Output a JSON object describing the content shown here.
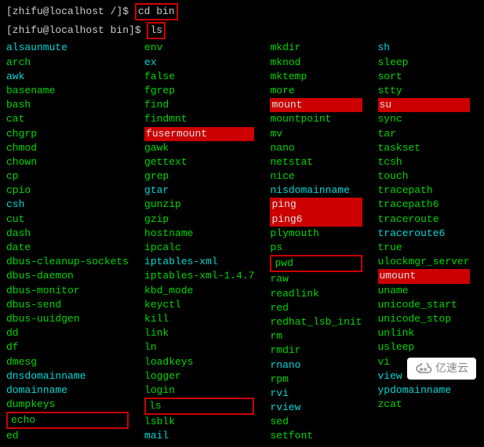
{
  "prompt1": {
    "full": "[zhifu@localhost /]$",
    "command": "cd bin"
  },
  "prompt2": {
    "full": "[zhifu@localhost bin]$",
    "command": "ls"
  },
  "columns": [
    [
      {
        "name": "alsaunmute",
        "style": "cyan"
      },
      {
        "name": "arch",
        "style": "green"
      },
      {
        "name": "awk",
        "style": "cyan"
      },
      {
        "name": "basename",
        "style": "green"
      },
      {
        "name": "bash",
        "style": "green"
      },
      {
        "name": "cat",
        "style": "green"
      },
      {
        "name": "chgrp",
        "style": "green"
      },
      {
        "name": "chmod",
        "style": "green"
      },
      {
        "name": "chown",
        "style": "green"
      },
      {
        "name": "cp",
        "style": "green"
      },
      {
        "name": "cpio",
        "style": "green"
      },
      {
        "name": "csh",
        "style": "cyan"
      },
      {
        "name": "cut",
        "style": "green"
      },
      {
        "name": "dash",
        "style": "green"
      },
      {
        "name": "date",
        "style": "green"
      },
      {
        "name": "dbus-cleanup-sockets",
        "style": "green"
      },
      {
        "name": "dbus-daemon",
        "style": "green"
      },
      {
        "name": "dbus-monitor",
        "style": "green"
      },
      {
        "name": "dbus-send",
        "style": "green"
      },
      {
        "name": "dbus-uuidgen",
        "style": "green"
      },
      {
        "name": "dd",
        "style": "green"
      },
      {
        "name": "df",
        "style": "green"
      },
      {
        "name": "dmesg",
        "style": "green"
      },
      {
        "name": "dnsdomainname",
        "style": "cyan"
      },
      {
        "name": "domainname",
        "style": "cyan"
      },
      {
        "name": "dumpkeys",
        "style": "green"
      },
      {
        "name": "echo",
        "style": "box-red"
      },
      {
        "name": "ed",
        "style": "green"
      }
    ],
    [
      {
        "name": "env",
        "style": "green"
      },
      {
        "name": "ex",
        "style": "cyan"
      },
      {
        "name": "false",
        "style": "green"
      },
      {
        "name": "fgrep",
        "style": "green"
      },
      {
        "name": "find",
        "style": "green"
      },
      {
        "name": "findmnt",
        "style": "green"
      },
      {
        "name": "fusermount",
        "style": "red-bg"
      },
      {
        "name": "gawk",
        "style": "green"
      },
      {
        "name": "gettext",
        "style": "green"
      },
      {
        "name": "grep",
        "style": "green"
      },
      {
        "name": "gtar",
        "style": "cyan"
      },
      {
        "name": "gunzip",
        "style": "green"
      },
      {
        "name": "gzip",
        "style": "green"
      },
      {
        "name": "hostname",
        "style": "green"
      },
      {
        "name": "ipcalc",
        "style": "green"
      },
      {
        "name": "iptables-xml",
        "style": "cyan"
      },
      {
        "name": "iptables-xml-1.4.7",
        "style": "green"
      },
      {
        "name": "kbd_mode",
        "style": "green"
      },
      {
        "name": "keyctl",
        "style": "green"
      },
      {
        "name": "kill",
        "style": "green"
      },
      {
        "name": "link",
        "style": "green"
      },
      {
        "name": "ln",
        "style": "green"
      },
      {
        "name": "loadkeys",
        "style": "green"
      },
      {
        "name": "logger",
        "style": "green"
      },
      {
        "name": "login",
        "style": "green"
      },
      {
        "name": "ls",
        "style": "box-red"
      },
      {
        "name": "lsblk",
        "style": "green"
      },
      {
        "name": "mail",
        "style": "cyan"
      }
    ],
    [
      {
        "name": "mkdir",
        "style": "green"
      },
      {
        "name": "mknod",
        "style": "green"
      },
      {
        "name": "mktemp",
        "style": "green"
      },
      {
        "name": "more",
        "style": "green"
      },
      {
        "name": "mount",
        "style": "red-bg"
      },
      {
        "name": "mountpoint",
        "style": "green"
      },
      {
        "name": "mv",
        "style": "green"
      },
      {
        "name": "nano",
        "style": "green"
      },
      {
        "name": "netstat",
        "style": "green"
      },
      {
        "name": "nice",
        "style": "green"
      },
      {
        "name": "nisdomainname",
        "style": "cyan"
      },
      {
        "name": "ping",
        "style": "red-bg"
      },
      {
        "name": "ping6",
        "style": "red-bg"
      },
      {
        "name": "plymouth",
        "style": "green"
      },
      {
        "name": "ps",
        "style": "green"
      },
      {
        "name": "pwd",
        "style": "box-red"
      },
      {
        "name": "raw",
        "style": "green"
      },
      {
        "name": "readlink",
        "style": "green"
      },
      {
        "name": "red",
        "style": "green"
      },
      {
        "name": "redhat_lsb_init",
        "style": "green"
      },
      {
        "name": "rm",
        "style": "green"
      },
      {
        "name": "rmdir",
        "style": "green"
      },
      {
        "name": "rnano",
        "style": "cyan"
      },
      {
        "name": "rpm",
        "style": "green"
      },
      {
        "name": "rvi",
        "style": "cyan"
      },
      {
        "name": "rview",
        "style": "cyan"
      },
      {
        "name": "sed",
        "style": "green"
      },
      {
        "name": "setfont",
        "style": "green"
      }
    ],
    [
      {
        "name": "sh",
        "style": "cyan"
      },
      {
        "name": "sleep",
        "style": "green"
      },
      {
        "name": "sort",
        "style": "green"
      },
      {
        "name": "stty",
        "style": "green"
      },
      {
        "name": "su",
        "style": "red-bg"
      },
      {
        "name": "sync",
        "style": "green"
      },
      {
        "name": "tar",
        "style": "green"
      },
      {
        "name": "taskset",
        "style": "green"
      },
      {
        "name": "tcsh",
        "style": "green"
      },
      {
        "name": "touch",
        "style": "green"
      },
      {
        "name": "tracepath",
        "style": "green"
      },
      {
        "name": "tracepath6",
        "style": "green"
      },
      {
        "name": "traceroute",
        "style": "green"
      },
      {
        "name": "traceroute6",
        "style": "cyan"
      },
      {
        "name": "true",
        "style": "green"
      },
      {
        "name": "ulockmgr_server",
        "style": "green"
      },
      {
        "name": "umount",
        "style": "red-bg"
      },
      {
        "name": "uname",
        "style": "green"
      },
      {
        "name": "unicode_start",
        "style": "green"
      },
      {
        "name": "unicode_stop",
        "style": "green"
      },
      {
        "name": "unlink",
        "style": "green"
      },
      {
        "name": "usleep",
        "style": "green"
      },
      {
        "name": "vi",
        "style": "green"
      },
      {
        "name": "view",
        "style": "cyan"
      },
      {
        "name": "ypdomainname",
        "style": "cyan"
      },
      {
        "name": "zcat",
        "style": "green"
      }
    ]
  ],
  "watermark": "亿速云"
}
